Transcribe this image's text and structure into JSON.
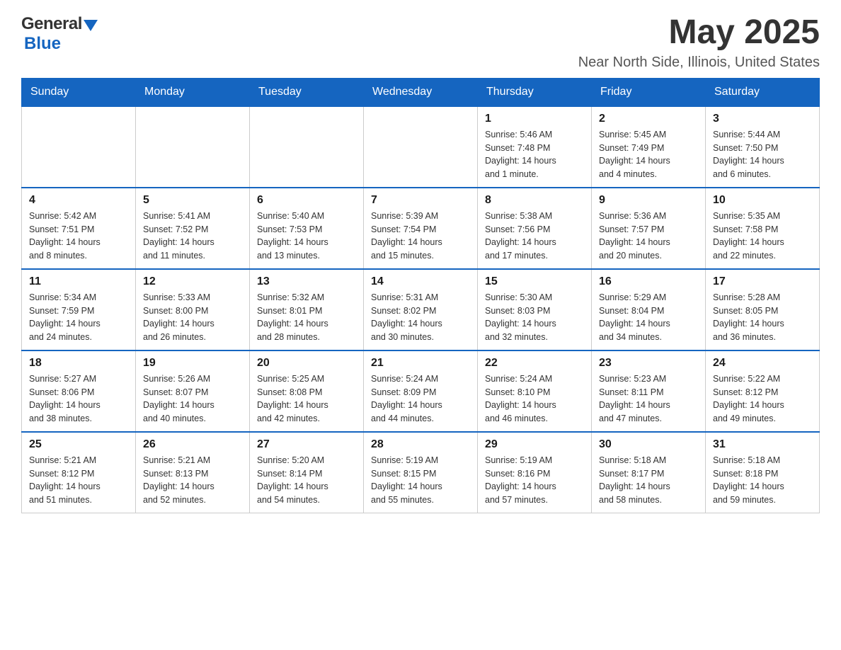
{
  "header": {
    "logo": {
      "general": "General",
      "blue": "Blue"
    },
    "title": "May 2025",
    "location": "Near North Side, Illinois, United States"
  },
  "weekdays": [
    "Sunday",
    "Monday",
    "Tuesday",
    "Wednesday",
    "Thursday",
    "Friday",
    "Saturday"
  ],
  "weeks": [
    {
      "days": [
        {
          "number": "",
          "info": ""
        },
        {
          "number": "",
          "info": ""
        },
        {
          "number": "",
          "info": ""
        },
        {
          "number": "",
          "info": ""
        },
        {
          "number": "1",
          "info": "Sunrise: 5:46 AM\nSunset: 7:48 PM\nDaylight: 14 hours\nand 1 minute."
        },
        {
          "number": "2",
          "info": "Sunrise: 5:45 AM\nSunset: 7:49 PM\nDaylight: 14 hours\nand 4 minutes."
        },
        {
          "number": "3",
          "info": "Sunrise: 5:44 AM\nSunset: 7:50 PM\nDaylight: 14 hours\nand 6 minutes."
        }
      ]
    },
    {
      "days": [
        {
          "number": "4",
          "info": "Sunrise: 5:42 AM\nSunset: 7:51 PM\nDaylight: 14 hours\nand 8 minutes."
        },
        {
          "number": "5",
          "info": "Sunrise: 5:41 AM\nSunset: 7:52 PM\nDaylight: 14 hours\nand 11 minutes."
        },
        {
          "number": "6",
          "info": "Sunrise: 5:40 AM\nSunset: 7:53 PM\nDaylight: 14 hours\nand 13 minutes."
        },
        {
          "number": "7",
          "info": "Sunrise: 5:39 AM\nSunset: 7:54 PM\nDaylight: 14 hours\nand 15 minutes."
        },
        {
          "number": "8",
          "info": "Sunrise: 5:38 AM\nSunset: 7:56 PM\nDaylight: 14 hours\nand 17 minutes."
        },
        {
          "number": "9",
          "info": "Sunrise: 5:36 AM\nSunset: 7:57 PM\nDaylight: 14 hours\nand 20 minutes."
        },
        {
          "number": "10",
          "info": "Sunrise: 5:35 AM\nSunset: 7:58 PM\nDaylight: 14 hours\nand 22 minutes."
        }
      ]
    },
    {
      "days": [
        {
          "number": "11",
          "info": "Sunrise: 5:34 AM\nSunset: 7:59 PM\nDaylight: 14 hours\nand 24 minutes."
        },
        {
          "number": "12",
          "info": "Sunrise: 5:33 AM\nSunset: 8:00 PM\nDaylight: 14 hours\nand 26 minutes."
        },
        {
          "number": "13",
          "info": "Sunrise: 5:32 AM\nSunset: 8:01 PM\nDaylight: 14 hours\nand 28 minutes."
        },
        {
          "number": "14",
          "info": "Sunrise: 5:31 AM\nSunset: 8:02 PM\nDaylight: 14 hours\nand 30 minutes."
        },
        {
          "number": "15",
          "info": "Sunrise: 5:30 AM\nSunset: 8:03 PM\nDaylight: 14 hours\nand 32 minutes."
        },
        {
          "number": "16",
          "info": "Sunrise: 5:29 AM\nSunset: 8:04 PM\nDaylight: 14 hours\nand 34 minutes."
        },
        {
          "number": "17",
          "info": "Sunrise: 5:28 AM\nSunset: 8:05 PM\nDaylight: 14 hours\nand 36 minutes."
        }
      ]
    },
    {
      "days": [
        {
          "number": "18",
          "info": "Sunrise: 5:27 AM\nSunset: 8:06 PM\nDaylight: 14 hours\nand 38 minutes."
        },
        {
          "number": "19",
          "info": "Sunrise: 5:26 AM\nSunset: 8:07 PM\nDaylight: 14 hours\nand 40 minutes."
        },
        {
          "number": "20",
          "info": "Sunrise: 5:25 AM\nSunset: 8:08 PM\nDaylight: 14 hours\nand 42 minutes."
        },
        {
          "number": "21",
          "info": "Sunrise: 5:24 AM\nSunset: 8:09 PM\nDaylight: 14 hours\nand 44 minutes."
        },
        {
          "number": "22",
          "info": "Sunrise: 5:24 AM\nSunset: 8:10 PM\nDaylight: 14 hours\nand 46 minutes."
        },
        {
          "number": "23",
          "info": "Sunrise: 5:23 AM\nSunset: 8:11 PM\nDaylight: 14 hours\nand 47 minutes."
        },
        {
          "number": "24",
          "info": "Sunrise: 5:22 AM\nSunset: 8:12 PM\nDaylight: 14 hours\nand 49 minutes."
        }
      ]
    },
    {
      "days": [
        {
          "number": "25",
          "info": "Sunrise: 5:21 AM\nSunset: 8:12 PM\nDaylight: 14 hours\nand 51 minutes."
        },
        {
          "number": "26",
          "info": "Sunrise: 5:21 AM\nSunset: 8:13 PM\nDaylight: 14 hours\nand 52 minutes."
        },
        {
          "number": "27",
          "info": "Sunrise: 5:20 AM\nSunset: 8:14 PM\nDaylight: 14 hours\nand 54 minutes."
        },
        {
          "number": "28",
          "info": "Sunrise: 5:19 AM\nSunset: 8:15 PM\nDaylight: 14 hours\nand 55 minutes."
        },
        {
          "number": "29",
          "info": "Sunrise: 5:19 AM\nSunset: 8:16 PM\nDaylight: 14 hours\nand 57 minutes."
        },
        {
          "number": "30",
          "info": "Sunrise: 5:18 AM\nSunset: 8:17 PM\nDaylight: 14 hours\nand 58 minutes."
        },
        {
          "number": "31",
          "info": "Sunrise: 5:18 AM\nSunset: 8:18 PM\nDaylight: 14 hours\nand 59 minutes."
        }
      ]
    }
  ]
}
